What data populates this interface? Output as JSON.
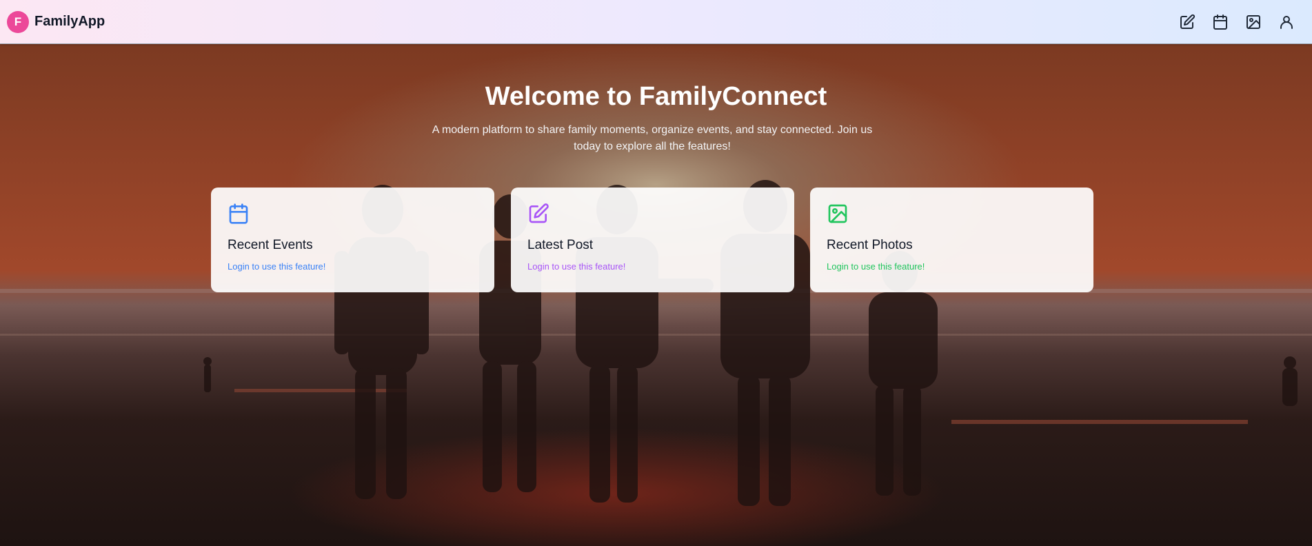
{
  "navbar": {
    "logo_letter": "F",
    "brand_name": "FamilyApp",
    "icons": [
      "edit-icon",
      "calendar-icon",
      "image-icon",
      "user-icon"
    ]
  },
  "hero": {
    "title": "Welcome to FamilyConnect",
    "subtitle": "A modern platform to share family moments, organize events, and stay connected. Join us today to explore all the features!"
  },
  "cards": [
    {
      "icon": "calendar-icon",
      "title": "Recent Events",
      "note": "Login to use this feature!",
      "accent": "#3b82f6"
    },
    {
      "icon": "edit-icon",
      "title": "Latest Post",
      "note": "Login to use this feature!",
      "accent": "#a855f7"
    },
    {
      "icon": "image-icon",
      "title": "Recent Photos",
      "note": "Login to use this feature!",
      "accent": "#22c55e"
    }
  ],
  "colors": {
    "logo_bg": "#ec4899",
    "events_accent": "#3b82f6",
    "post_accent": "#a855f7",
    "photos_accent": "#22c55e"
  }
}
